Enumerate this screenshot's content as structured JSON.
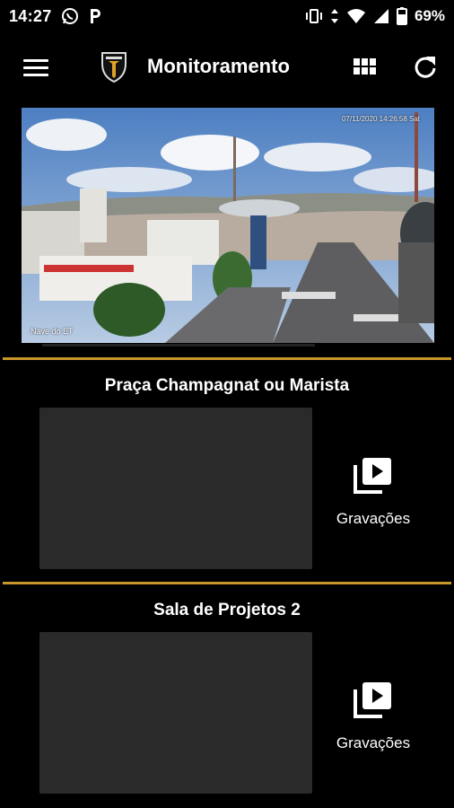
{
  "status_bar": {
    "time": "14:27",
    "battery_percent": "69%",
    "icons": [
      "whatsapp-icon",
      "p-app-icon",
      "vibrate-icon",
      "data-arrows-icon",
      "wifi-icon",
      "signal-icon",
      "battery-icon"
    ]
  },
  "app_bar": {
    "title": "Monitoramento",
    "icons": [
      "menu-icon",
      "logo",
      "grid-view-icon",
      "refresh-icon"
    ]
  },
  "live_feed": {
    "label": "Nave do ET",
    "timestamp": "07/11/2020 14:26:58 Sat"
  },
  "cameras": [
    {
      "name": "Praça Champagnat ou Marista",
      "recordings_label": "Gravações"
    },
    {
      "name": "Sala de Projetos 2",
      "recordings_label": "Gravações"
    }
  ],
  "colors": {
    "background": "#000000",
    "accent_divider": "#c8962a",
    "thumbnail": "#2a2a2a",
    "text": "#ffffff"
  }
}
